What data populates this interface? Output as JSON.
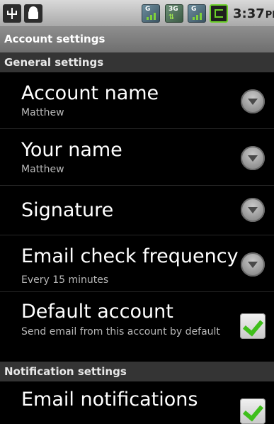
{
  "status_bar": {
    "icons": [
      "usb-icon",
      "android-icon",
      "signal-icon",
      "3g-icon",
      "signal-icon",
      "battery-charging-icon"
    ],
    "signal_letter": "G",
    "network_type": "3G",
    "time": "3:37",
    "ampm": "PM"
  },
  "title": "Account settings",
  "sections": {
    "general": "General settings",
    "notification": "Notification settings"
  },
  "prefs": {
    "account_name": {
      "title": "Account name",
      "summary": "Matthew"
    },
    "your_name": {
      "title": "Your name",
      "summary": "Matthew"
    },
    "signature": {
      "title": "Signature"
    },
    "check_frequency": {
      "title": "Email check frequency",
      "summary": "Every 15 minutes"
    },
    "default_account": {
      "title": "Default account",
      "summary": "Send email from this account by default",
      "checked": true
    },
    "email_notifications": {
      "title": "Email notifications",
      "checked": true
    }
  },
  "colors": {
    "background": "#000000",
    "section_header": "#343434",
    "title_bar": "#7e7e7e",
    "check_green": "#3fbf1b"
  }
}
